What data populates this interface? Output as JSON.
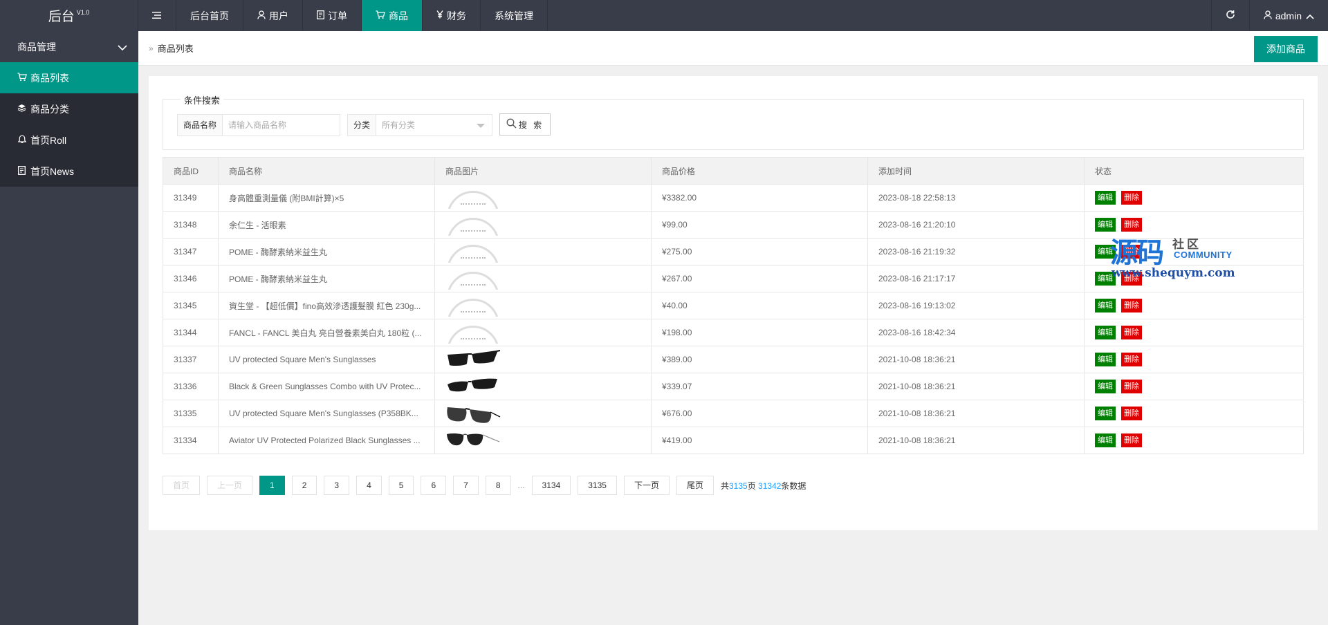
{
  "topbar": {
    "logo": "后台",
    "version": "V1.0",
    "nav": [
      {
        "label": "后台首页",
        "icon": ""
      },
      {
        "label": "用户",
        "icon": "user-icon"
      },
      {
        "label": "订单",
        "icon": "document-icon"
      },
      {
        "label": "商品",
        "icon": "cart-icon"
      },
      {
        "label": "财务",
        "icon": "yen-icon"
      },
      {
        "label": "系统管理",
        "icon": ""
      }
    ],
    "active_index": 3,
    "user": "admin"
  },
  "sidebar": {
    "group": "商品管理",
    "items": [
      {
        "label": "商品列表",
        "icon": "cart-icon"
      },
      {
        "label": "商品分类",
        "icon": "layers-icon"
      },
      {
        "label": "首页Roll",
        "icon": "bell-icon"
      },
      {
        "label": "首页News",
        "icon": "document-icon"
      }
    ]
  },
  "breadcrumb": {
    "current": "商品列表"
  },
  "add_button": "添加商品",
  "search": {
    "legend": "条件搜索",
    "name_label": "商品名称",
    "name_placeholder": "请输入商品名称",
    "category_label": "分类",
    "category_value": "所有分类",
    "button": "搜 索"
  },
  "table": {
    "headers": [
      "商品ID",
      "商品名称",
      "商品图片",
      "商品价格",
      "添加时间",
      "状态"
    ],
    "edit_label": "编辑",
    "delete_label": "删除",
    "rows": [
      {
        "id": "31349",
        "name": "身高體重測量儀 (附BMI計算)×5",
        "image": "placeholder",
        "price": "¥3382.00",
        "time": "2023-08-18 22:58:13"
      },
      {
        "id": "31348",
        "name": "余仁生 - 活眼素",
        "image": "placeholder",
        "price": "¥99.00",
        "time": "2023-08-16 21:20:10"
      },
      {
        "id": "31347",
        "name": "POME - 酶酵素納米益生丸",
        "image": "placeholder",
        "price": "¥275.00",
        "time": "2023-08-16 21:19:32"
      },
      {
        "id": "31346",
        "name": "POME - 酶酵素納米益生丸",
        "image": "placeholder",
        "price": "¥267.00",
        "time": "2023-08-16 21:17:17"
      },
      {
        "id": "31345",
        "name": "資生堂 - 【超低價】fino高效滲透護髮膜 紅色 230g...",
        "image": "placeholder",
        "price": "¥40.00",
        "time": "2023-08-16 19:13:02"
      },
      {
        "id": "31344",
        "name": "FANCL - FANCL 美白丸 亮白營養素美白丸 180粒 (...",
        "image": "placeholder",
        "price": "¥198.00",
        "time": "2023-08-16 18:42:34"
      },
      {
        "id": "31337",
        "name": "UV protected Square Men's Sunglasses",
        "image": "sunglasses-square",
        "price": "¥389.00",
        "time": "2021-10-08 18:36:21"
      },
      {
        "id": "31336",
        "name": "Black & Green Sunglasses Combo with UV Protec...",
        "image": "sunglasses-wrap",
        "price": "¥339.07",
        "time": "2021-10-08 18:36:21"
      },
      {
        "id": "31335",
        "name": "UV protected Square Men's Sunglasses (P358BK...",
        "image": "sunglasses-round",
        "price": "¥676.00",
        "time": "2021-10-08 18:36:21"
      },
      {
        "id": "31334",
        "name": "Aviator UV Protected Polarized Black Sunglasses ...",
        "image": "sunglasses-aviator",
        "price": "¥419.00",
        "time": "2021-10-08 18:36:21"
      }
    ]
  },
  "pagination": {
    "first": "首页",
    "prev": "上一页",
    "pages": [
      "1",
      "2",
      "3",
      "4",
      "5",
      "6",
      "7",
      "8"
    ],
    "current": "1",
    "ellipsis": "...",
    "tail_pages": [
      "3134",
      "3135"
    ],
    "next": "下一页",
    "last": "尾页",
    "info_prefix": "共",
    "total_pages": "3135",
    "info_mid": "页 ",
    "total_records": "31342",
    "info_suffix": "条数据"
  },
  "watermark": {
    "big": "源码",
    "cn": "社区",
    "en": "COMMUNITY",
    "url": "www.shequym.com"
  }
}
